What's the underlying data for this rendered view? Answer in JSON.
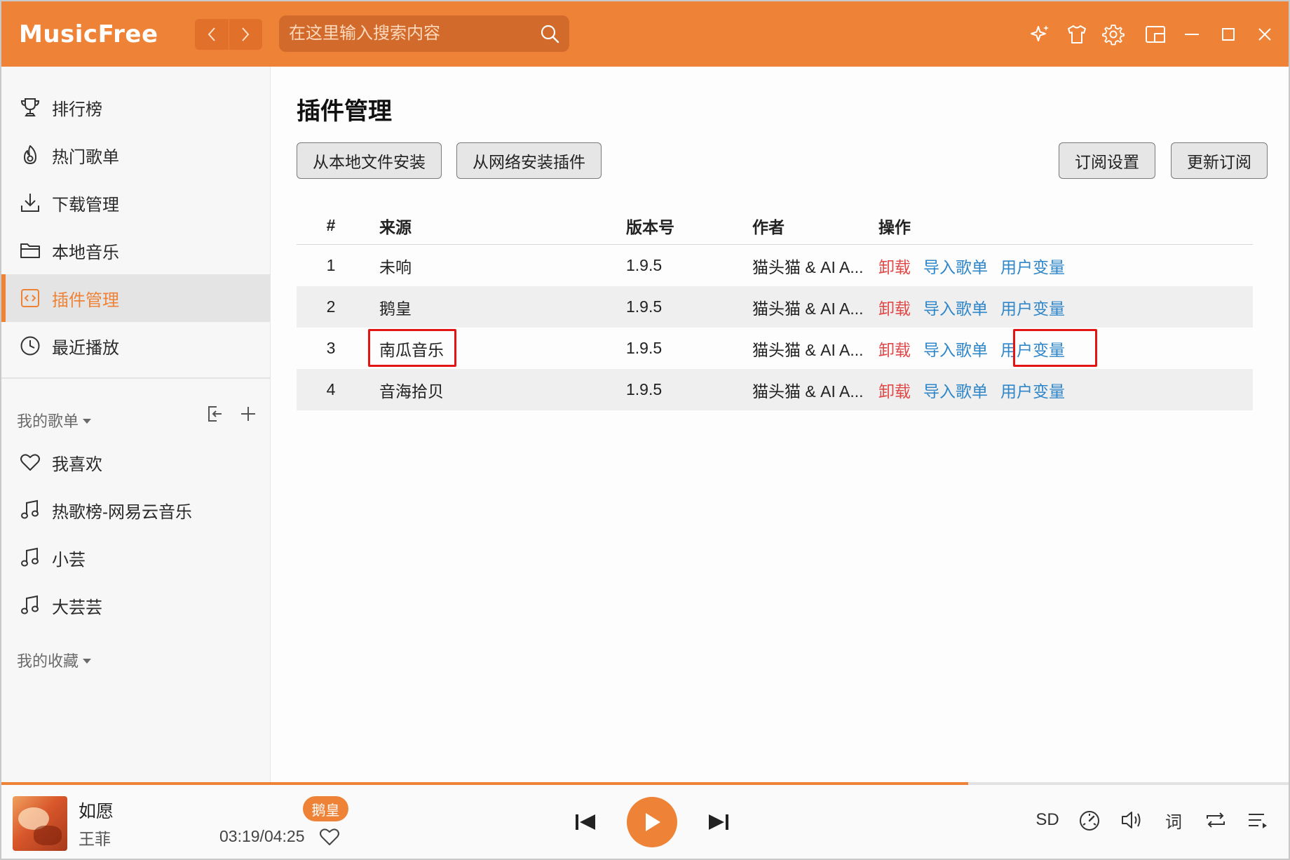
{
  "app": {
    "logo_text": "MusicFree",
    "accent_color": "#ee8236"
  },
  "titlebar": {
    "search_placeholder": "在这里输入搜索内容",
    "nav_back_icon": "chevron-left-icon",
    "nav_forward_icon": "chevron-right-icon",
    "icons": [
      "sparkle-icon",
      "tshirt-icon",
      "gear-icon",
      "mini-window-icon",
      "minimize-icon",
      "maximize-icon",
      "close-icon"
    ]
  },
  "sidebar": {
    "items": [
      {
        "label": "排行榜",
        "icon": "trophy-icon"
      },
      {
        "label": "热门歌单",
        "icon": "fire-icon"
      },
      {
        "label": "下载管理",
        "icon": "download-icon"
      },
      {
        "label": "本地音乐",
        "icon": "folder-icon"
      },
      {
        "label": "插件管理",
        "icon": "plugin-icon",
        "active": true
      },
      {
        "label": "最近播放",
        "icon": "clock-icon"
      }
    ],
    "my_playlists_label": "我的歌单",
    "playlists": [
      {
        "label": "我喜欢",
        "icon": "heart-icon"
      },
      {
        "label": "热歌榜-网易云音乐",
        "icon": "music-note-icon"
      },
      {
        "label": "小芸",
        "icon": "music-note-icon"
      },
      {
        "label": "大芸芸",
        "icon": "music-note-icon"
      }
    ],
    "my_favorites_label": "我的收藏"
  },
  "main": {
    "title": "插件管理",
    "buttons": {
      "install_local": "从本地文件安装",
      "install_network": "从网络安装插件",
      "subscription_settings": "订阅设置",
      "update_subscription": "更新订阅"
    },
    "table": {
      "headers": {
        "index": "#",
        "source": "来源",
        "version": "版本号",
        "author": "作者",
        "actions": "操作"
      },
      "rows": [
        {
          "index": "1",
          "source": "未响",
          "version": "1.9.5",
          "author": "猫头猫 & AI A..."
        },
        {
          "index": "2",
          "source": "鹅皇",
          "version": "1.9.5",
          "author": "猫头猫 & AI A..."
        },
        {
          "index": "3",
          "source": "南瓜音乐",
          "version": "1.9.5",
          "author": "猫头猫 & AI A..."
        },
        {
          "index": "4",
          "source": "音海拾贝",
          "version": "1.9.5",
          "author": "猫头猫 & AI A..."
        }
      ],
      "action_labels": {
        "uninstall": "卸载",
        "import_playlist": "导入歌单",
        "user_variables": "用户变量"
      }
    }
  },
  "player": {
    "song_title": "如愿",
    "artist": "王菲",
    "source_badge": "鹅皇",
    "time": "03:19/04:25",
    "progress": 0.751,
    "quality": "SD",
    "lyrics_label": "词"
  }
}
